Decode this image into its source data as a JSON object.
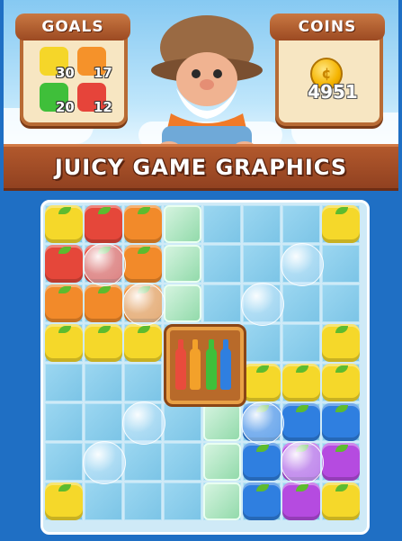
{
  "goals_panel": {
    "title": "GOALS",
    "items": [
      {
        "fruit": "yellow-apple",
        "count": "30",
        "color": "#f5d629"
      },
      {
        "fruit": "orange",
        "count": "17",
        "color": "#f5922a"
      },
      {
        "fruit": "green-apple",
        "count": "20",
        "color": "#3fbf3a"
      },
      {
        "fruit": "red-tomato",
        "count": "12",
        "color": "#e6443a"
      }
    ]
  },
  "coins_panel": {
    "title": "COINS",
    "value": "4951",
    "icon": "coin-icon"
  },
  "banner": {
    "text": "JUICY GAME GRAPHICS"
  },
  "board": {
    "colors": {
      "yellow": "#f5d82a",
      "red": "#e5473a",
      "orange": "#f28a2a",
      "blue": "#2f7fe0",
      "purple": "#b54be0",
      "green": "#62c043"
    }
  }
}
